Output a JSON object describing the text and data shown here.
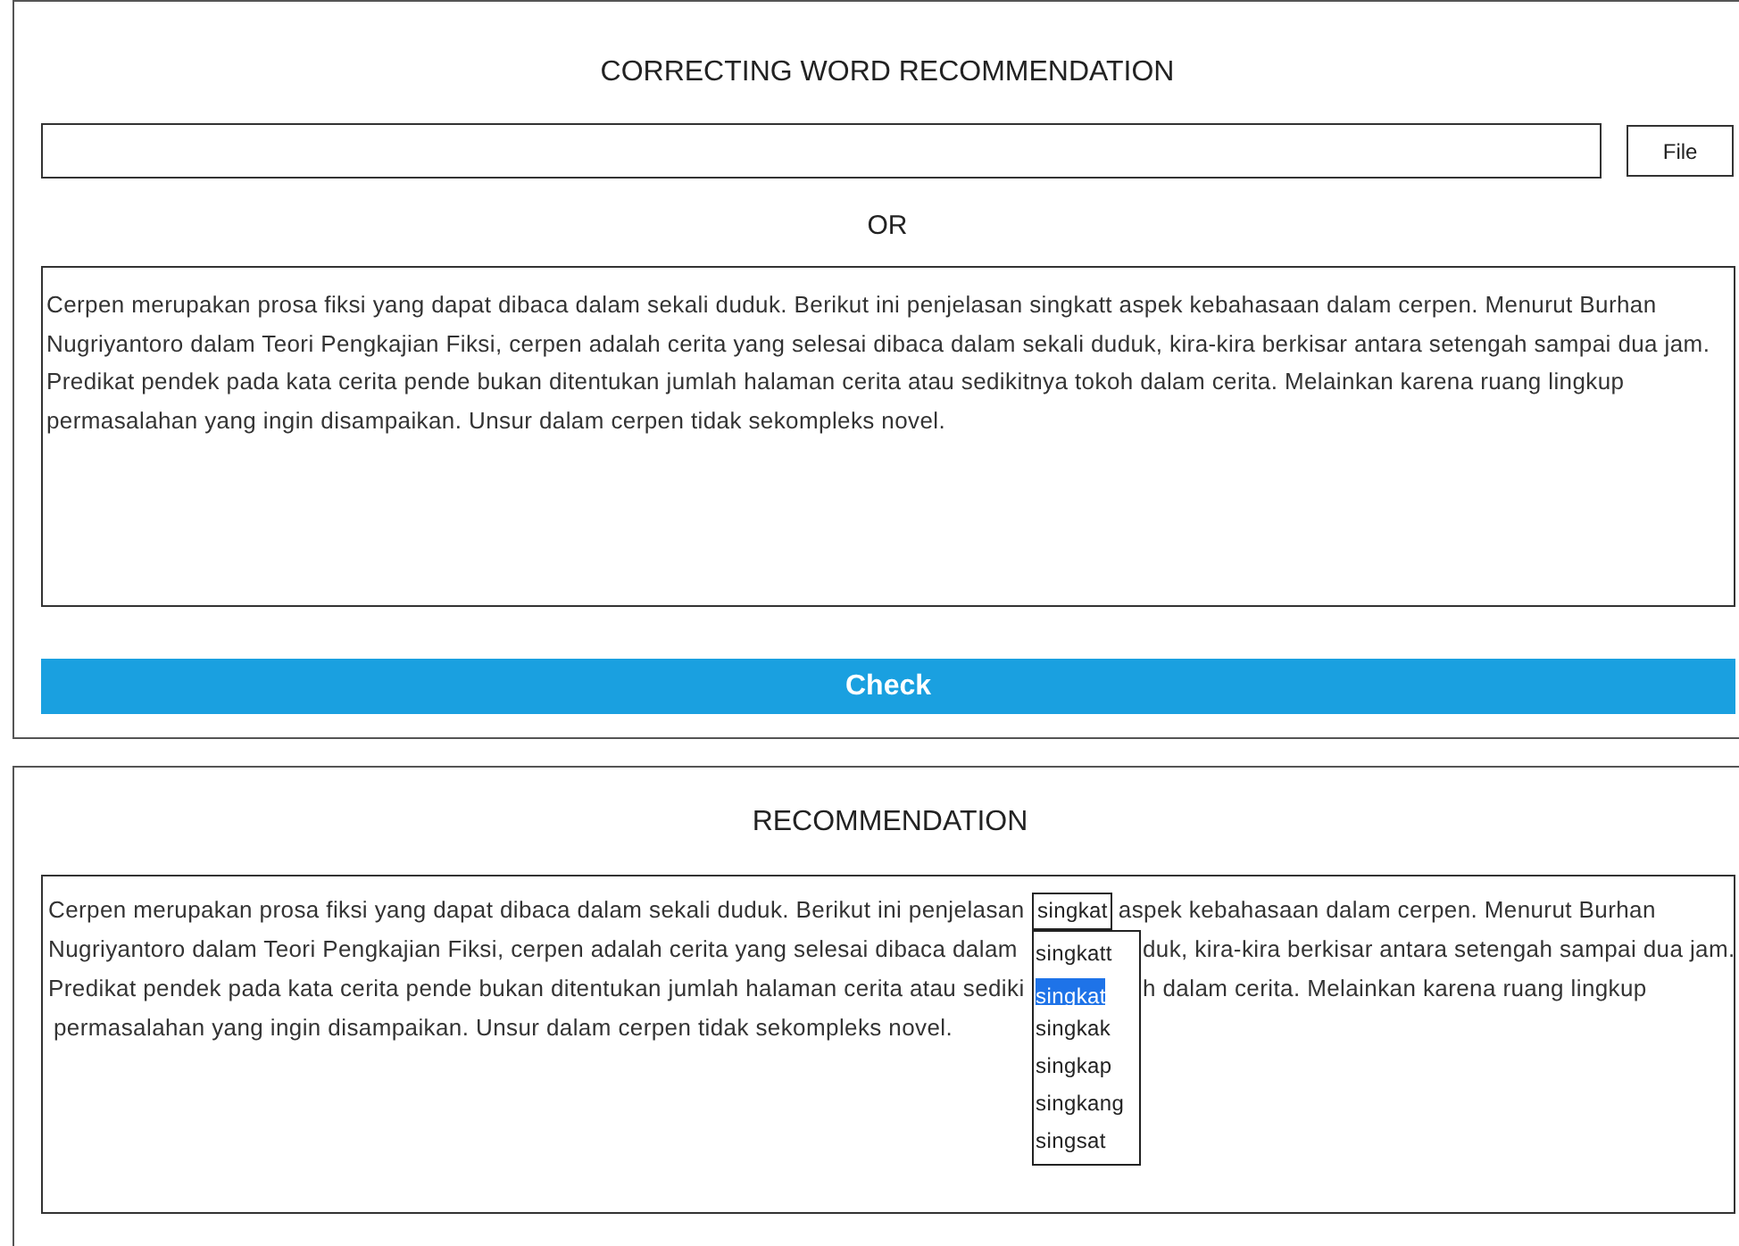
{
  "form": {
    "title": "CORRECTING WORD RECOMMENDATION",
    "file_button": "File",
    "separator": "OR",
    "text": "Cerpen merupakan prosa fiksi yang dapat dibaca dalam sekali duduk. Berikut ini penjelasan singkatt aspek kebahasaan dalam cerpen. Menurut Burhan Nugriyantoro dalam Teori Pengkajian Fiksi, cerpen adalah cerita yang selesai dibaca dalam sekali duduk, kira-kira berkisar antara setengah sampai dua jam. Predikat pendek pada kata cerita pende bukan ditentukan jumlah halaman cerita atau sedikitnya tokoh dalam cerita. Melainkan karena ruang lingkup permasalahan yang ingin disampaikan. Unsur dalam cerpen tidak sekompleks novel.",
    "check_button": "Check"
  },
  "recommendation": {
    "title": "RECOMMENDATION",
    "lines": [
      [
        {
          "kind": "left",
          "text": "Cerpen merupakan prosa fiksi yang dapat dibaca dalam sekali duduk. Berikut ini penjelasan"
        },
        {
          "kind": "choice",
          "value": "singkat",
          "options": [
            {
              "label": "singkatt",
              "selected": false
            },
            {
              "label": "singkat",
              "selected": true
            },
            {
              "label": "singkak",
              "selected": false
            },
            {
              "label": "singkap",
              "selected": false
            },
            {
              "label": "singkang",
              "selected": false
            },
            {
              "label": "singsat",
              "selected": false
            }
          ]
        },
        {
          "kind": "text",
          "text": "aspek kebahasaan dalam cerpen. Menurut Burhan"
        }
      ],
      [
        {
          "kind": "left",
          "text": "Nugriyantoro dalam Teori Pengkajian Fiksi, cerpen adalah cerita yang selesai dibaca dalam"
        },
        {
          "kind": "text",
          "text": "duk, kira-kira berkisar antara setengah sampai dua jam."
        }
      ],
      [
        {
          "kind": "left",
          "text": "Predikat pendek pada kata cerita pende bukan ditentukan jumlah halaman cerita atau sediki"
        },
        {
          "kind": "text",
          "text": "h dalam cerita. Melainkan karena ruang lingkup"
        }
      ],
      [
        {
          "kind": "text",
          "text": "permasalahan yang ingin disampaikan. Unsur dalam cerpen tidak sekompleks novel."
        }
      ]
    ]
  }
}
